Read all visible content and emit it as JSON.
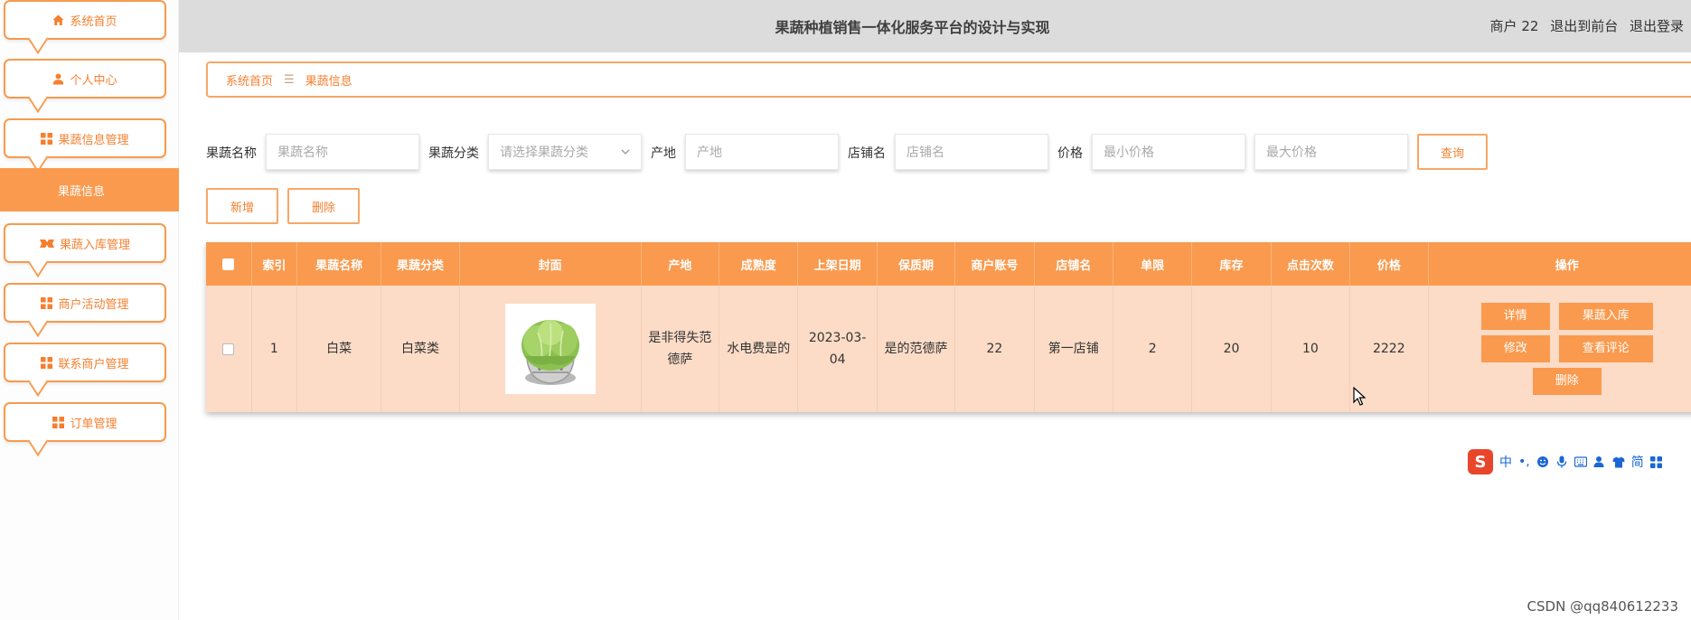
{
  "header": {
    "title": "果蔬种植销售一体化服务平台的设计与实现",
    "user": "商户 22",
    "exit_front": "退出到前台",
    "exit_login": "退出登录"
  },
  "sidebar": {
    "items": [
      {
        "label": "系统首页",
        "icon": "home-icon"
      },
      {
        "label": "个人中心",
        "icon": "user-icon"
      },
      {
        "label": "果蔬信息管理",
        "icon": "grid-icon"
      },
      {
        "label": "果蔬入库管理",
        "icon": "ticket-icon"
      },
      {
        "label": "商户活动管理",
        "icon": "grid-icon"
      },
      {
        "label": "联系商户管理",
        "icon": "grid-icon"
      },
      {
        "label": "订单管理",
        "icon": "grid-icon"
      }
    ],
    "active_sub": "果蔬信息"
  },
  "breadcrumb": {
    "home": "系统首页",
    "sep": "☰",
    "current": "果蔬信息"
  },
  "search": {
    "name_label": "果蔬名称",
    "name_placeholder": "果蔬名称",
    "category_label": "果蔬分类",
    "category_placeholder": "请选择果蔬分类",
    "origin_label": "产地",
    "origin_placeholder": "产地",
    "shop_label": "店铺名",
    "shop_placeholder": "店铺名",
    "price_label": "价格",
    "min_price_placeholder": "最小价格",
    "max_price_placeholder": "最大价格",
    "query_button": "查询"
  },
  "actions": {
    "add": "新增",
    "delete": "删除"
  },
  "table": {
    "columns": [
      "索引",
      "果蔬名称",
      "果蔬分类",
      "封面",
      "产地",
      "成熟度",
      "上架日期",
      "保质期",
      "商户账号",
      "店铺名",
      "单限",
      "库存",
      "点击次数",
      "价格",
      "操作"
    ],
    "rows": [
      {
        "index": "1",
        "name": "白菜",
        "category": "白菜类",
        "origin": "是非得失范德萨",
        "maturity": "水电费是的",
        "date": "2023-03-04",
        "shelf_life": "是的范德萨",
        "merchant": "22",
        "shop": "第一店铺",
        "limit": "2",
        "stock": "20",
        "clicks": "10",
        "price": "2222",
        "ops": {
          "detail": "详情",
          "stock_in": "果蔬入库",
          "edit": "修改",
          "reviews": "查看评论",
          "delete": "删除"
        }
      }
    ]
  },
  "ime": {
    "logo": "S",
    "lang": "中",
    "punct": "•,",
    "simp": "简"
  },
  "watermark": "CSDN @qq840612233",
  "colors": {
    "accent": "#fa9a4e",
    "accent_text": "#f57f2f",
    "row_bg": "#fcdcc7",
    "header_bg": "#dcdcdc"
  }
}
